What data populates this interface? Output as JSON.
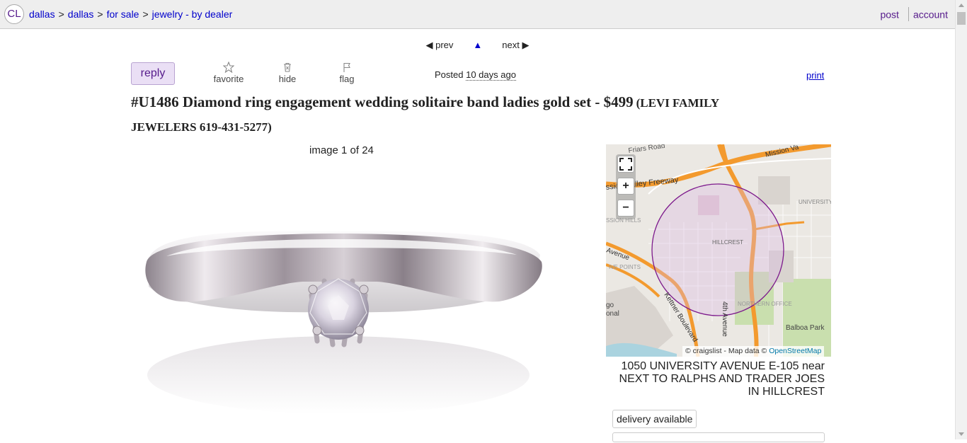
{
  "header": {
    "logo": "CL",
    "breadcrumbs": [
      "dallas",
      "dallas",
      "for sale",
      "jewelry - by dealer"
    ],
    "breadcrumb_sep": ">",
    "post_link": "post",
    "account_link": "account"
  },
  "pager": {
    "prev": "◀ prev",
    "up": "▲",
    "next": "next ▶"
  },
  "actions": {
    "reply": "reply",
    "favorite": "favorite",
    "hide": "hide",
    "flag": "flag",
    "posted_label": "Posted",
    "posted_date": "10 days ago",
    "print": "print"
  },
  "listing": {
    "title": "#U1486 Diamond ring engagement wedding solitaire band ladies gold set",
    "price_sep": " - ",
    "price": "$499",
    "location": "(LEVI FAMILY JEWELERS 619-431-5277)",
    "image_caption": "image 1 of 24"
  },
  "map": {
    "labels": {
      "friars_road": "Friars Road",
      "mission_valley": "Mission Va",
      "freeway": "ssion Valley Freeway",
      "university_heights": "UNIVERSITY HEIGHTS",
      "mission_hills": "SSION HILLS",
      "hillcrest": "HILLCREST",
      "avenue": "Avenue",
      "five_points": "IVE POINTS",
      "kettner": "Kettner Boulevard",
      "fourth_ave": "4th Avenue",
      "northern": "NORTHERN OFFICE",
      "go": "go",
      "onal": "onal",
      "balboa": "Balboa Park"
    },
    "attribution_prefix": "© craigslist - Map data ©",
    "attribution_link": "OpenStreetMap",
    "zoom_in": "+",
    "zoom_out": "−",
    "colors": {
      "highway": "#f39a2e",
      "radius_fill": "#d9b8e3",
      "radius_stroke": "#7d1a8c",
      "park": "#c9dfae"
    }
  },
  "address": "1050 UNIVERSITY AVENUE E-105 near NEXT TO RALPHS AND TRADER JOES IN HILLCREST",
  "attributes": [
    "delivery available"
  ]
}
